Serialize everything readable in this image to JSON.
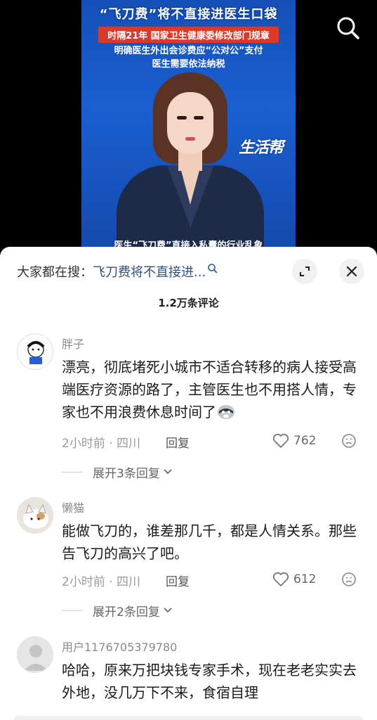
{
  "video": {
    "headline": "“飞刀费”将不直接进医生口袋",
    "subhead_1": "时隔21年 国家卫生健康委修改部门规章",
    "subhead_2": "明确医生外出会诊费应“公对公”支付",
    "subhead_3": "医生需要依法纳税",
    "brand": "生活帮",
    "bottom_caption": "医生“飞刀费”直接入私囊的行业乱象",
    "search_icon": "search-icon"
  },
  "panel": {
    "search_prefix": "大家都在搜：",
    "search_query": "飞刀费将不直接进...",
    "expand_icon": "expand-icon",
    "close_icon": "close-icon",
    "comment_count": "1.2万条评论"
  },
  "comments": [
    {
      "name": "胖子",
      "text": "漂亮，彻底堵死小城市不适合转移的病人接受高端医疗资源的路了，主管医生也不用搭人情，专家也不用浪费休息时间了",
      "emoji": "raccoon-emoji",
      "time": "2小时前 · 四川",
      "reply": "回复",
      "likes": "762",
      "expand": "展开3条回复"
    },
    {
      "name": "懒猫",
      "text": "能做飞刀的，谁差那几千，都是人情关系。那些告飞刀的高兴了吧。",
      "time": "2小时前 · 四川",
      "reply": "回复",
      "likes": "612",
      "expand": "展开2条回复"
    },
    {
      "name": "用户1176705379780",
      "text": "哈哈，原来万把块钱专家手术，现在老老实实去外地，没几万下不来，食宿自理"
    }
  ]
}
